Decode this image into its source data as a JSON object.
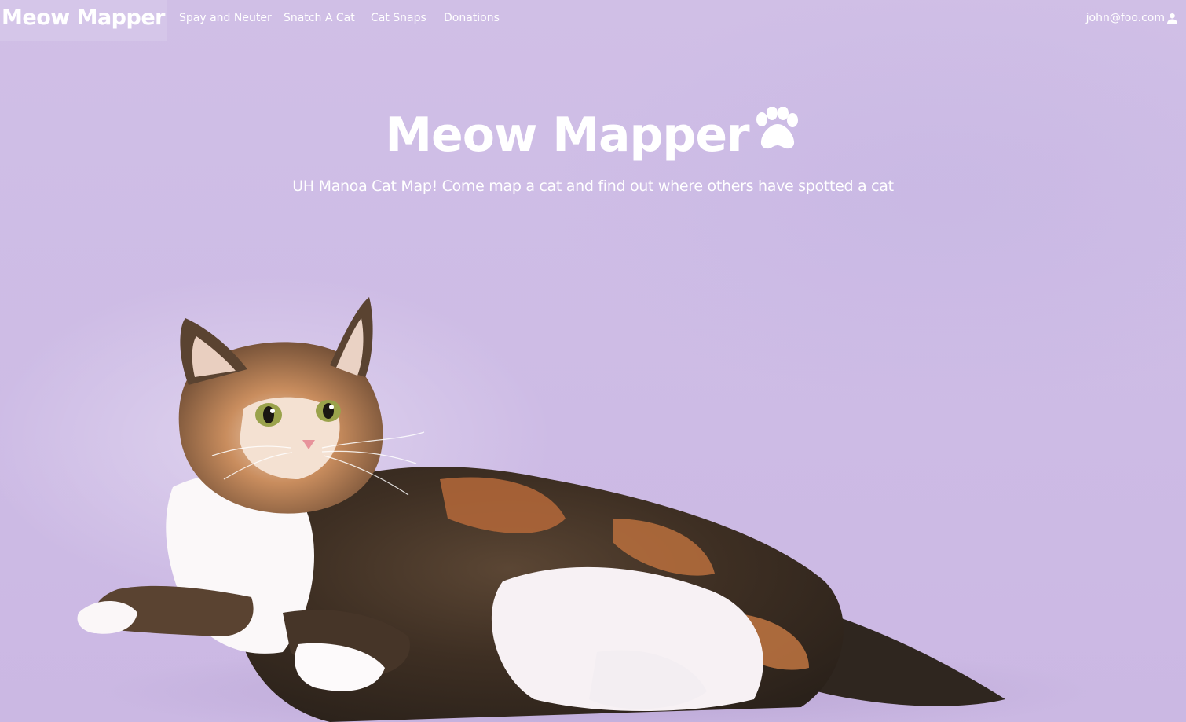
{
  "navbar": {
    "brand": "Meow Mapper",
    "items": [
      {
        "label": "Spay and Neuter"
      },
      {
        "label": "Snatch A Cat"
      },
      {
        "label": "Cat Snaps"
      },
      {
        "label": "Donations"
      }
    ],
    "user": {
      "email": "john@foo.com",
      "icon": "user-icon"
    }
  },
  "hero": {
    "title": "Meow Mapper",
    "title_icon": "paw-icon",
    "subtitle": "UH Manoa Cat Map! Come map a cat and find out where others have spotted a cat"
  },
  "colors": {
    "background": "#cfbde5",
    "text": "#ffffff"
  }
}
